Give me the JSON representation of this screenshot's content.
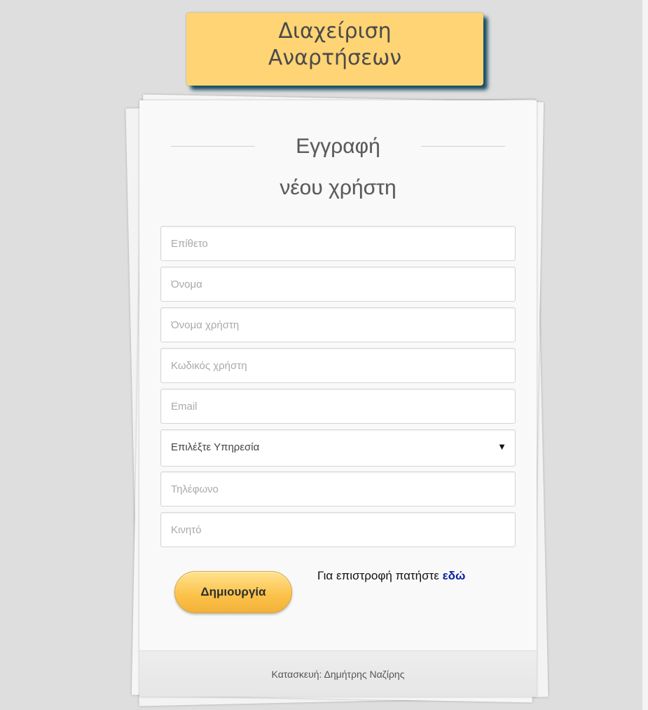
{
  "header": {
    "title_line1": "Διαχείριση",
    "title_line2": "Αναρτήσεων"
  },
  "form": {
    "title_line1": "Εγγραφή",
    "title_line2": "νέου χρήστη",
    "fields": {
      "surname": {
        "placeholder": "Επίθετο",
        "value": ""
      },
      "first_name": {
        "placeholder": "Όνομα",
        "value": ""
      },
      "username": {
        "placeholder": "Όνομα χρήστη",
        "value": ""
      },
      "password": {
        "placeholder": "Κωδικός χρήστη",
        "value": ""
      },
      "email": {
        "placeholder": "Email",
        "value": ""
      },
      "service": {
        "selected": "Επιλέξτε Υπηρεσία"
      },
      "phone": {
        "placeholder": "Τηλέφωνο",
        "value": ""
      },
      "mobile": {
        "placeholder": "Κινητό",
        "value": ""
      }
    },
    "submit_label": "Δημιουργία",
    "back_text": "Για επιστροφή πατήστε",
    "back_link": "εδώ"
  },
  "footer": {
    "credit": "Κατασκευή: Δημήτρης Ναζίρης"
  },
  "colors": {
    "banner": "#ffd475",
    "banner_shadow": "#15495e",
    "button": "#fbc148",
    "link": "#0a1f9f"
  },
  "icons": {
    "select_caret": "▼"
  }
}
